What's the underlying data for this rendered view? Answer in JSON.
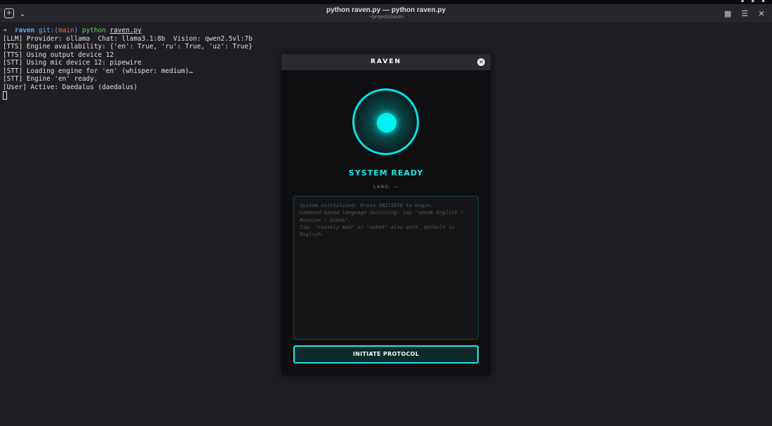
{
  "window": {
    "title": "python raven.py — python raven.py",
    "subtitle": "~/projects/raven"
  },
  "terminal": {
    "prompt": {
      "dir": "raven",
      "git": "git:(",
      "branch": "main",
      "git_close": ")",
      "command": "python",
      "arg": "raven.py"
    },
    "lines": [
      "[LLM] Provider: ollama  Chat: llama3.1:8b  Vision: qwen2.5vl:7b",
      "[TTS] Engine availability: {'en': True, 'ru': True, 'uz': True}",
      "[TTS] Using output device 12",
      "[STT] Using mic device 12: pipewire",
      "[STT] Loading engine for 'en' (whisper: medium)…",
      "[STT] Engine 'en' ready.",
      "[User] Active: Daedalus (daedalus)"
    ]
  },
  "dialog": {
    "title": "RAVEN",
    "status": "SYSTEM READY",
    "lang": "LANG: —",
    "log": "System initialised. Press INITIATE to begin.\nCommand-based language switching: say \"speak English / Russian / Uzbek\".\nTip: \"russkiy mod\" or \"uzbek\" also work. Default is English.",
    "initiate_label": "INITIATE PROTOCOL"
  },
  "colors": {
    "accent": "#1ee8e8",
    "background": "#1e1e24",
    "dialog_bg": "#0f0f11"
  },
  "icons": {
    "new_tab": "new-tab-icon",
    "dropdown": "chevron-down-icon",
    "grid": "grid-icon",
    "menu": "hamburger-menu-icon",
    "close": "close-icon"
  }
}
